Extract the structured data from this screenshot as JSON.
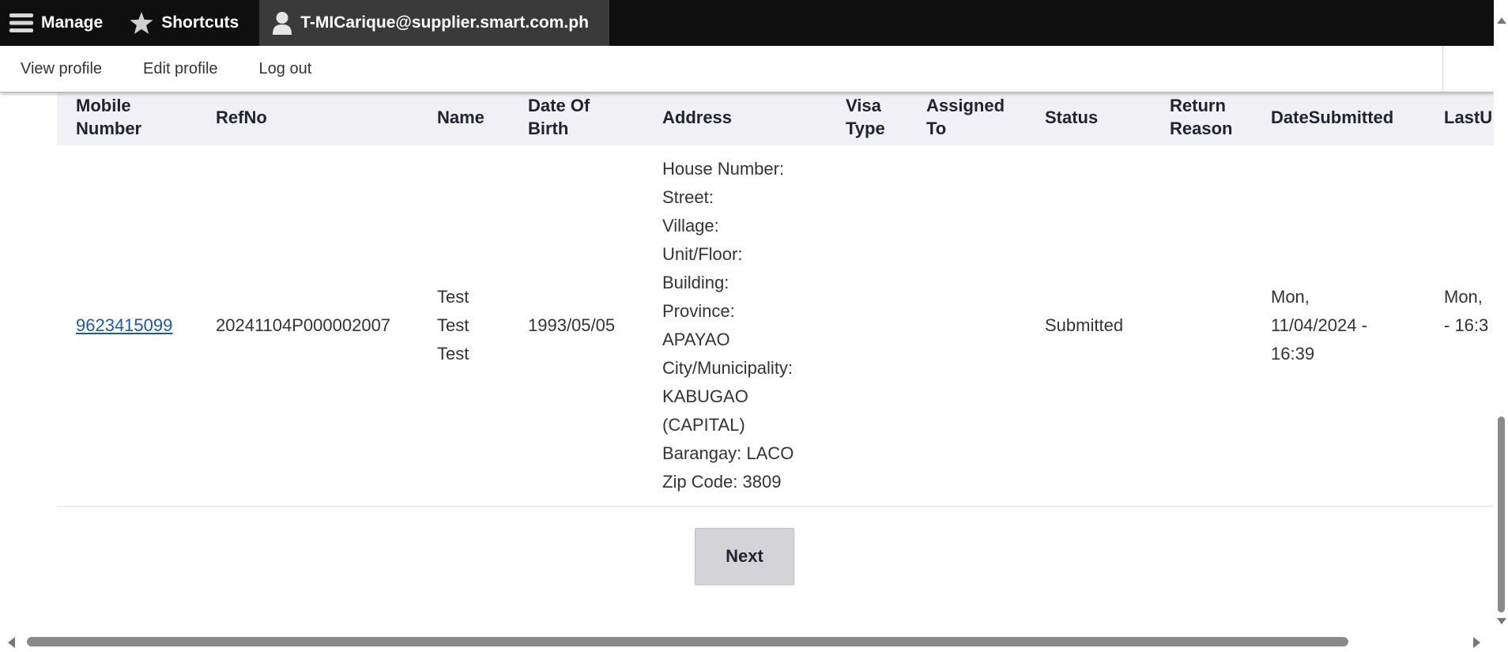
{
  "toolbar": {
    "manage_label": "Manage",
    "shortcuts_label": "Shortcuts",
    "user_label": "T-MICarique@supplier.smart.com.ph"
  },
  "tray": {
    "view_profile": "View profile",
    "edit_profile": "Edit profile",
    "log_out": "Log out"
  },
  "table": {
    "headers": {
      "mobile": "Mobile Number",
      "refno": "RefNo",
      "name": "Name",
      "dob": "Date Of Birth",
      "address": "Address",
      "visa": "Visa Type",
      "assigned": "Assigned To",
      "status": "Status",
      "return_reason": "Return Reason",
      "date_submitted": "DateSubmitted",
      "last_updated": "LastU"
    },
    "row": {
      "mobile": "9623415099",
      "refno": "20241104P000002007",
      "name_lines": [
        "Test",
        "Test",
        "Test"
      ],
      "dob": "1993/05/05",
      "address_lines": [
        "House Number:",
        "Street:",
        "Village:",
        "Unit/Floor:",
        "Building:",
        "Province:",
        "APAYAO",
        "City/Municipality:",
        "KABUGAO",
        "(CAPITAL)",
        "Barangay: LACO",
        "Zip Code: 3809"
      ],
      "visa": "",
      "assigned": "",
      "status": "Submitted",
      "return_reason": "",
      "date_submitted_lines": [
        "Mon,",
        "11/04/2024 -",
        "16:39"
      ],
      "last_updated_lines": [
        "Mon,",
        "- 16:3"
      ]
    }
  },
  "pager": {
    "next_label": "Next"
  }
}
